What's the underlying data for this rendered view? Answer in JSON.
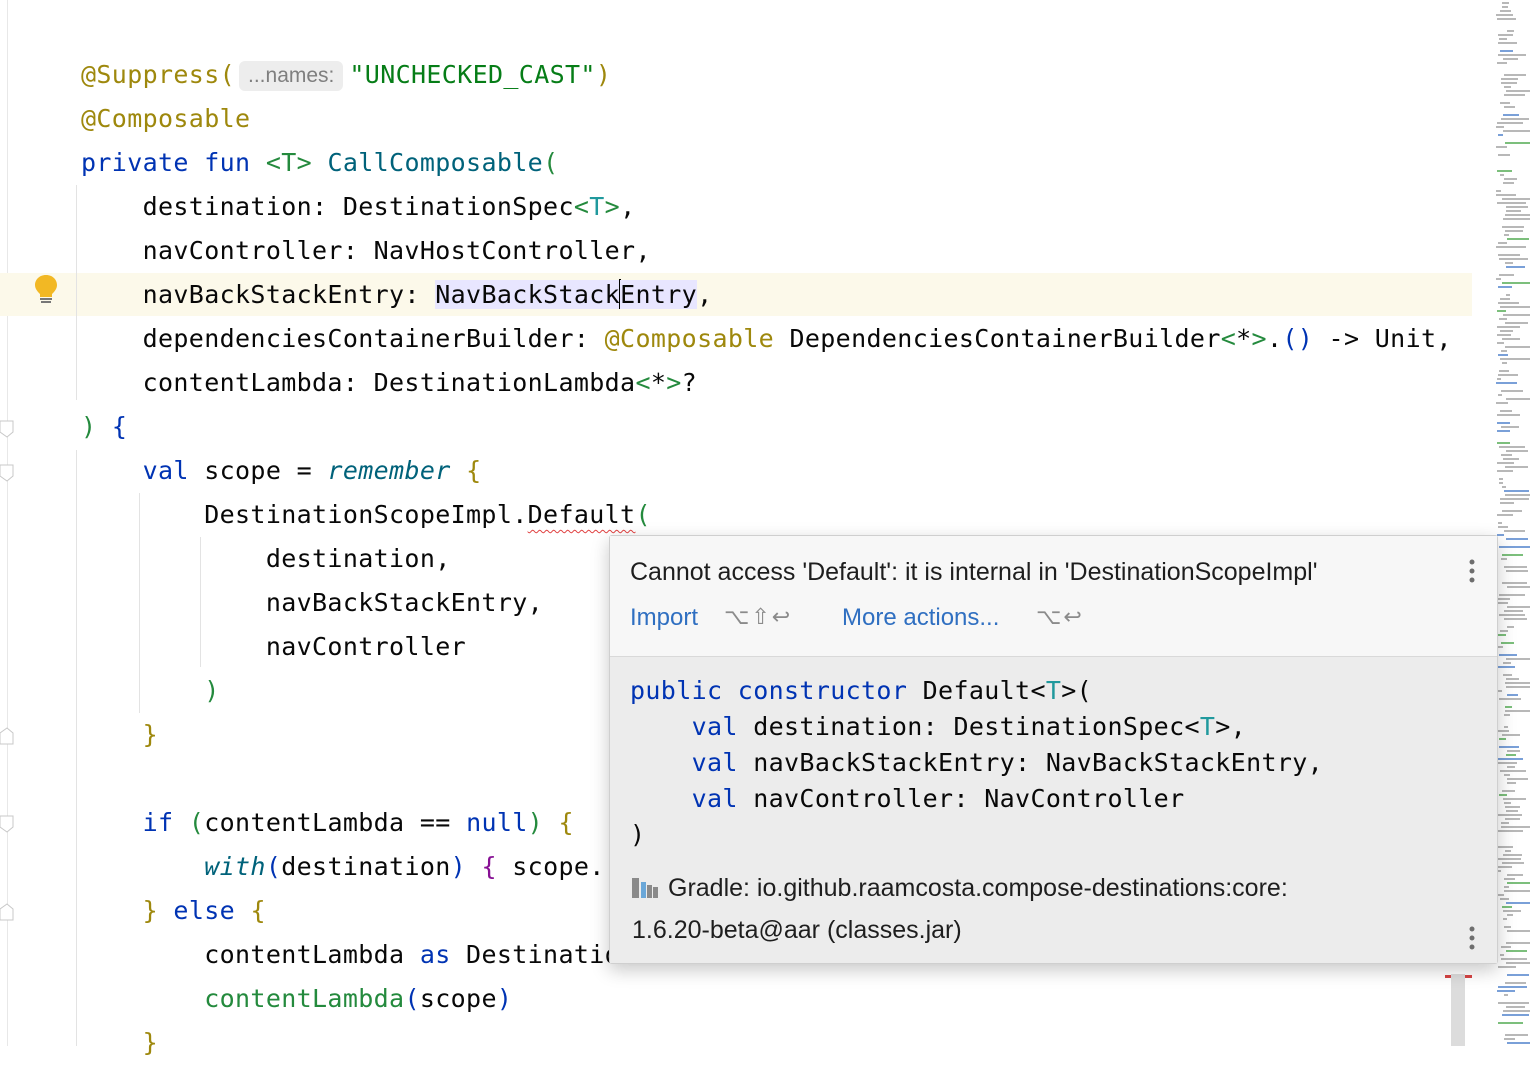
{
  "editor": {
    "lines": [
      {
        "id": "l1",
        "tokens": [
          {
            "t": "@Suppress(",
            "c": "ann"
          },
          {
            "hint": "...names:"
          },
          {
            "t": "\"UNCHECKED_CAST\"",
            "c": "str"
          },
          {
            "t": ")",
            "c": "ann"
          }
        ]
      },
      {
        "id": "l2",
        "tokens": [
          {
            "t": "@Composable",
            "c": "ann"
          }
        ]
      },
      {
        "id": "l3",
        "tokens": [
          {
            "t": "private fun ",
            "c": "kw"
          },
          {
            "t": "<T> ",
            "c": "gr"
          },
          {
            "t": "CallComposable",
            "c": "fn"
          },
          {
            "t": "(",
            "c": "gr"
          }
        ]
      },
      {
        "id": "l4",
        "tokens": [
          {
            "t": "    destination: DestinationSpec"
          },
          {
            "t": "<",
            "c": "gr"
          },
          {
            "t": "T",
            "c": "tp"
          },
          {
            "t": ">",
            "c": "gr"
          },
          {
            "t": ","
          }
        ]
      },
      {
        "id": "l5",
        "tokens": [
          {
            "t": "    navController: NavHostController,"
          }
        ]
      },
      {
        "id": "l6",
        "tokens": [
          {
            "t": "    navBackStackEntry: "
          },
          {
            "t": "NavBackStack",
            "c": "hl"
          },
          {
            "caret": true
          },
          {
            "t": "Entry",
            "c": "hl"
          },
          {
            "t": ","
          }
        ]
      },
      {
        "id": "l7",
        "tokens": [
          {
            "t": "    dependenciesContainerBuilder: "
          },
          {
            "t": "@Composable",
            "c": "ann"
          },
          {
            "t": " DependenciesContainerBuilder"
          },
          {
            "t": "<",
            "c": "gr"
          },
          {
            "t": "*"
          },
          {
            "t": ">",
            "c": "gr"
          },
          {
            "t": "."
          },
          {
            "t": "()",
            "c": "br"
          },
          {
            "t": " -> Unit,"
          }
        ]
      },
      {
        "id": "l8",
        "tokens": [
          {
            "t": "    contentLambda: DestinationLambda"
          },
          {
            "t": "<",
            "c": "gr"
          },
          {
            "t": "*"
          },
          {
            "t": ">",
            "c": "gr"
          },
          {
            "t": "?"
          }
        ]
      },
      {
        "id": "l9",
        "tokens": [
          {
            "t": ")",
            "c": "gr"
          },
          {
            "t": " "
          },
          {
            "t": "{",
            "c": "br"
          }
        ]
      },
      {
        "id": "l10",
        "tokens": [
          {
            "t": "    "
          },
          {
            "t": "val",
            "c": "kw"
          },
          {
            "t": " scope = "
          },
          {
            "t": "remember",
            "c": "it"
          },
          {
            "t": " "
          },
          {
            "t": "{",
            "c": "lam"
          }
        ]
      },
      {
        "id": "l11",
        "tokens": [
          {
            "t": "        DestinationScopeImpl."
          },
          {
            "t": "Default",
            "c": "err"
          },
          {
            "t": "(",
            "c": "gr"
          }
        ]
      },
      {
        "id": "l12",
        "tokens": [
          {
            "t": "            destination,"
          }
        ]
      },
      {
        "id": "l13",
        "tokens": [
          {
            "t": "            navBackStackEntry,"
          }
        ]
      },
      {
        "id": "l14",
        "tokens": [
          {
            "t": "            navController"
          }
        ]
      },
      {
        "id": "l15",
        "tokens": [
          {
            "t": "        "
          },
          {
            "t": ")",
            "c": "gr"
          }
        ]
      },
      {
        "id": "l16",
        "tokens": [
          {
            "t": "    "
          },
          {
            "t": "}",
            "c": "lam"
          }
        ]
      },
      {
        "id": "l17",
        "tokens": [
          {
            "t": ""
          }
        ]
      },
      {
        "id": "l18",
        "tokens": [
          {
            "t": "    "
          },
          {
            "t": "if",
            "c": "kw"
          },
          {
            "t": " "
          },
          {
            "t": "(",
            "c": "gr"
          },
          {
            "t": "contentLambda == "
          },
          {
            "t": "null",
            "c": "kw"
          },
          {
            "t": ")",
            "c": "gr"
          },
          {
            "t": " "
          },
          {
            "t": "{",
            "c": "lam"
          }
        ]
      },
      {
        "id": "l19",
        "tokens": [
          {
            "t": "        "
          },
          {
            "t": "with",
            "c": "it"
          },
          {
            "t": "(",
            "c": "br"
          },
          {
            "t": "destination"
          },
          {
            "t": ")",
            "c": "br"
          },
          {
            "t": " "
          },
          {
            "t": "{",
            "c": "mg"
          },
          {
            "t": " scope."
          }
        ]
      },
      {
        "id": "l20",
        "tokens": [
          {
            "t": "    "
          },
          {
            "t": "}",
            "c": "lam"
          },
          {
            "t": " "
          },
          {
            "t": "else",
            "c": "kw"
          },
          {
            "t": " "
          },
          {
            "t": "{",
            "c": "lam"
          }
        ]
      },
      {
        "id": "l21",
        "tokens": [
          {
            "t": "        contentLambda "
          },
          {
            "t": "as",
            "c": "kw"
          },
          {
            "t": " DestinationLambda<*>"
          }
        ]
      },
      {
        "id": "l22",
        "tokens": [
          {
            "t": "        "
          },
          {
            "t": "contentLambda",
            "c": "gr"
          },
          {
            "t": "(",
            "c": "br"
          },
          {
            "t": "scope"
          },
          {
            "t": ")",
            "c": "br"
          }
        ]
      },
      {
        "id": "l23",
        "tokens": [
          {
            "t": "    "
          },
          {
            "t": "}",
            "c": "lam"
          }
        ]
      }
    ]
  },
  "popup": {
    "message": "Cannot access 'Default': it is internal in 'DestinationScopeImpl'",
    "import_label": "Import",
    "import_shortcut": "⌥⇧↩",
    "more_label": "More actions...",
    "more_shortcut": "⌥↩",
    "doc_lines": [
      [
        {
          "t": "public constructor",
          "c": "kw"
        },
        {
          "t": " Default<"
        },
        {
          "t": "T",
          "c": "tp"
        },
        {
          "t": ">("
        }
      ],
      [
        {
          "t": "    "
        },
        {
          "t": "val",
          "c": "kw"
        },
        {
          "t": " destination: DestinationSpec<"
        },
        {
          "t": "T",
          "c": "tp"
        },
        {
          "t": ">,"
        }
      ],
      [
        {
          "t": "    "
        },
        {
          "t": "val",
          "c": "kw"
        },
        {
          "t": " navBackStackEntry: NavBackStackEntry,"
        }
      ],
      [
        {
          "t": "    "
        },
        {
          "t": "val",
          "c": "kw"
        },
        {
          "t": " navController: NavController"
        }
      ],
      [
        {
          "t": ")"
        }
      ]
    ],
    "source_line1": "Gradle: io.github.raamcosta.compose-destinations:core:",
    "source_line2": "1.6.20-beta@aar (classes.jar)"
  },
  "icons": {
    "bulb": "lightbulb-icon",
    "library": "library-icon",
    "kebab": "more-vertical-icon"
  }
}
